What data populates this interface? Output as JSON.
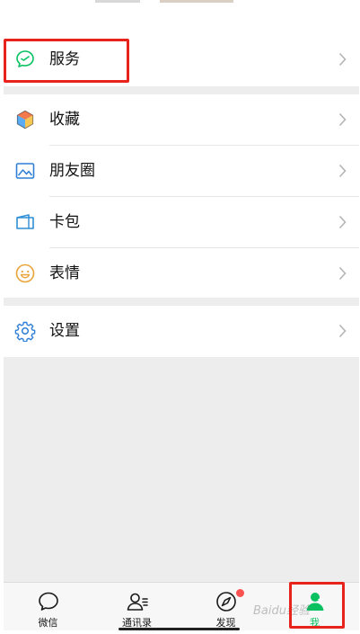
{
  "menu": {
    "group1": [
      {
        "label": "服务",
        "icon": "service-icon"
      }
    ],
    "group2": [
      {
        "label": "收藏",
        "icon": "favorites-cube-icon"
      },
      {
        "label": "朋友圈",
        "icon": "moments-picture-icon"
      },
      {
        "label": "卡包",
        "icon": "card-wallet-icon"
      },
      {
        "label": "表情",
        "icon": "smiley-icon"
      }
    ],
    "group3": [
      {
        "label": "设置",
        "icon": "gear-icon"
      }
    ]
  },
  "tabbar": {
    "tabs": [
      {
        "label": "微信",
        "icon": "chat-bubble-icon",
        "active": false
      },
      {
        "label": "通讯录",
        "icon": "contacts-icon",
        "active": false
      },
      {
        "label": "发现",
        "icon": "compass-icon",
        "active": false,
        "badge": "red-dot"
      },
      {
        "label": "我",
        "icon": "person-icon",
        "active": true
      }
    ]
  },
  "colors": {
    "active": "#07c160",
    "highlight_border": "#e8231c",
    "badge": "#fa5151",
    "background": "#ededed"
  },
  "watermark": "Baidu经验"
}
